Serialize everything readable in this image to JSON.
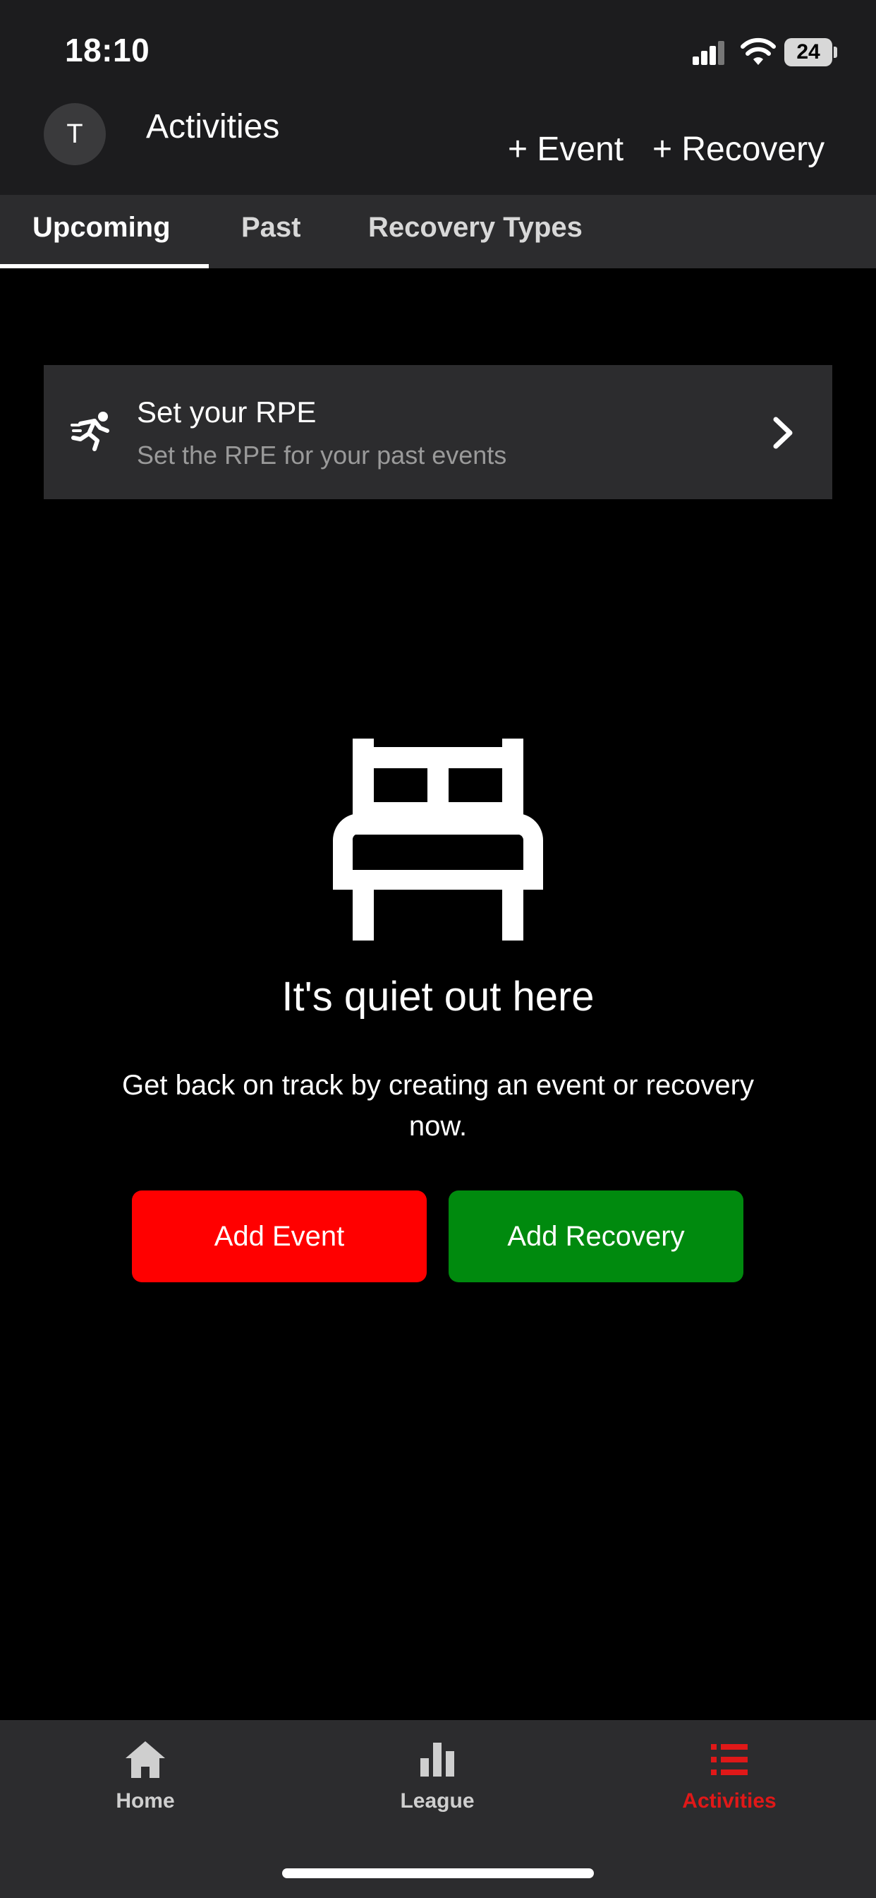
{
  "status_bar": {
    "time": "18:10",
    "battery": "24"
  },
  "header": {
    "avatar_initial": "T",
    "title": "Activities",
    "add_event": "+ Event",
    "add_recovery": "+ Recovery"
  },
  "tabs": [
    {
      "label": "Upcoming",
      "active": true
    },
    {
      "label": "Past",
      "active": false
    },
    {
      "label": "Recovery Types",
      "active": false
    }
  ],
  "rpe_card": {
    "title": "Set your RPE",
    "subtitle": "Set the RPE for your past events",
    "icon": "running-person-icon"
  },
  "empty_state": {
    "icon": "bed-icon",
    "title": "It's quiet out here",
    "body": "Get back on track by creating an event or recovery now."
  },
  "buttons": {
    "add_event": "Add Event",
    "add_recovery": "Add Recovery"
  },
  "colors": {
    "event": "#ff0000",
    "recovery": "#008a0e",
    "active_nav": "#e01818",
    "surface": "#2c2c2e"
  },
  "bottom_nav": [
    {
      "label": "Home",
      "icon": "home-icon",
      "active": false
    },
    {
      "label": "League",
      "icon": "bar-chart-icon",
      "active": false
    },
    {
      "label": "Activities",
      "icon": "list-icon",
      "active": true
    }
  ]
}
